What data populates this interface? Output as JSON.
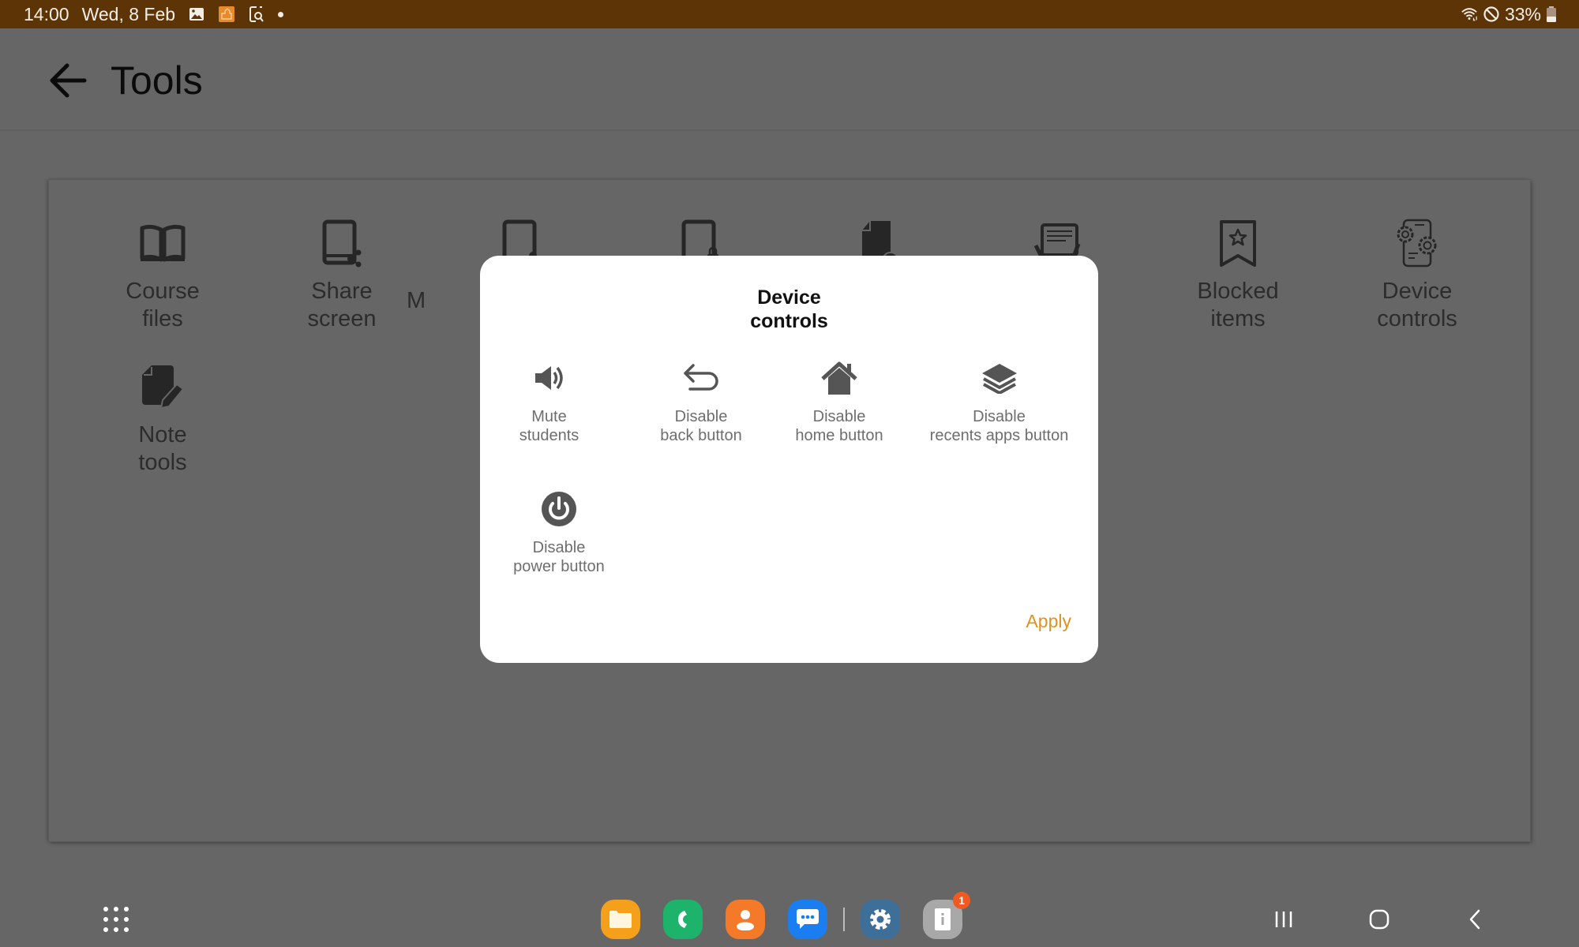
{
  "status_bar": {
    "time": "14:00",
    "date": "Wed, 8 Feb",
    "notification_icons": [
      "gallery-icon",
      "classroom-app-icon",
      "screen-search-icon",
      "more-dot-icon"
    ],
    "system_icons": [
      "wifi-icon",
      "do-not-disturb-icon"
    ],
    "battery": "33%",
    "colors": {
      "background": "#5c3406",
      "text": "#f3ede6"
    }
  },
  "header": {
    "back_icon": "arrow-left-icon",
    "title": "Tools"
  },
  "tools": [
    {
      "id": "course-files",
      "label": "Course\nfiles",
      "icon": "open-book-icon"
    },
    {
      "id": "share-screen",
      "label": "Share\nscreen",
      "icon": "tablet-share-icon"
    },
    {
      "id": "monitor",
      "label": "M",
      "icon": "tablet-user-icon"
    },
    {
      "id": "lock-screen",
      "label": "",
      "icon": "tablet-lock-icon"
    },
    {
      "id": "media",
      "label": "",
      "icon": "document-play-icon"
    },
    {
      "id": "exam",
      "label": "",
      "icon": "tablet-hands-icon"
    },
    {
      "id": "blocked-items",
      "label": "Blocked\nitems",
      "icon": "bookmark-star-icon"
    },
    {
      "id": "device-controls",
      "label": "Device\ncontrols",
      "icon": "phone-gears-icon"
    },
    {
      "id": "note-tools",
      "label": "Note\ntools",
      "icon": "note-pencil-icon"
    }
  ],
  "dialog": {
    "title": "Device\ncontrols",
    "controls": [
      {
        "id": "mute-students",
        "label": "Mute\nstudents",
        "icon": "speaker-icon"
      },
      {
        "id": "disable-back",
        "label": "Disable\nback button",
        "icon": "back-arrow-icon"
      },
      {
        "id": "disable-home",
        "label": "Disable\nhome button",
        "icon": "home-icon"
      },
      {
        "id": "disable-recents",
        "label": "Disable\nrecents apps button",
        "icon": "layers-icon"
      },
      {
        "id": "disable-power",
        "label": "Disable\npower button",
        "icon": "power-icon"
      }
    ],
    "apply_label": "Apply",
    "accent_color": "#e0921e"
  },
  "taskbar": {
    "apps_icon": "apps-grid-icon",
    "dock": [
      {
        "id": "my-files",
        "icon": "folder-icon",
        "color": "#f5a01a"
      },
      {
        "id": "phone",
        "icon": "phone-icon",
        "color": "#1db36a"
      },
      {
        "id": "contacts",
        "icon": "person-icon",
        "color": "#f47a2a"
      },
      {
        "id": "messages",
        "icon": "chat-icon",
        "color": "#1a7ef0"
      },
      {
        "id": "settings",
        "icon": "gear-icon",
        "color": "#3d6f98"
      },
      {
        "id": "classroom-info",
        "icon": "tablet-info-icon",
        "color": "#a8a8a8",
        "badge": "1"
      }
    ],
    "nav": [
      "recents-icon",
      "home-circle-icon",
      "back-chevron-icon"
    ]
  }
}
